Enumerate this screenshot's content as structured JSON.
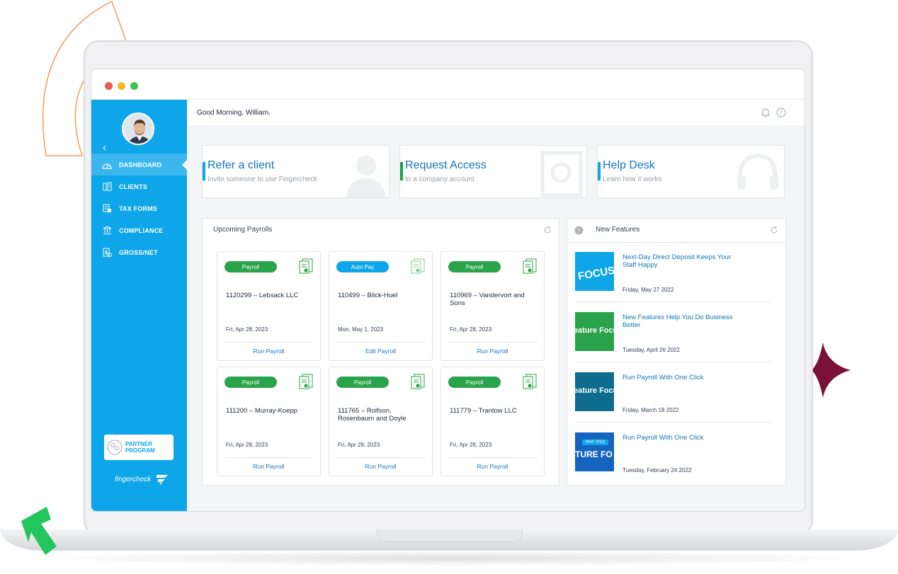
{
  "window": {
    "dot_colors": [
      "#ed5a50",
      "#f5b928",
      "#3ec44c"
    ]
  },
  "sidebar": {
    "back_icon": "chevron-left-icon",
    "items": [
      {
        "label": "DASHBOARD",
        "icon": "gauge-icon",
        "active": true
      },
      {
        "label": "CLIENTS",
        "icon": "buildings-icon",
        "active": false
      },
      {
        "label": "TAX FORMS",
        "icon": "tax-form-icon",
        "active": false
      },
      {
        "label": "COMPLIANCE",
        "icon": "bank-icon",
        "active": false
      },
      {
        "label": "GROSS/NET",
        "icon": "calculator-icon",
        "active": false
      }
    ],
    "partner": {
      "line1": "PARTNER",
      "line2": "PROGRAM"
    },
    "brand": "fingercheck"
  },
  "header": {
    "greeting": "Good Morning, William."
  },
  "quick_cards": [
    {
      "title": "Refer a client",
      "subtitle": "Invite someone to use Fingercheck",
      "accent": "#0ea5e9",
      "icon": "person-silhouette-icon"
    },
    {
      "title": "Request Access",
      "subtitle": "to a company account",
      "accent": "#16a34a",
      "icon": "vault-icon"
    },
    {
      "title": "Help Desk",
      "subtitle": "Learn how it works",
      "accent": "#0ea5e9",
      "icon": "headset-icon"
    }
  ],
  "payrolls": {
    "title": "Upcoming Payrolls",
    "cards": [
      {
        "status": "Payroll",
        "status_color": "#2aa34a",
        "name": "1120299 – Lebsack LLC",
        "date": "Fri, Apr 28, 2023",
        "action": "Run Payroll"
      },
      {
        "status": "Auto Pay",
        "status_color": "#0ea5e9",
        "name": "110499 – Blick-Huel",
        "date": "Mon, May 1, 2023",
        "action": "Edit Payroll"
      },
      {
        "status": "Payroll",
        "status_color": "#2aa34a",
        "name": "110969 – Vandervort and Sons",
        "date": "Fri, Apr 28, 2023",
        "action": "Run Payroll"
      },
      {
        "status": "Payroll",
        "status_color": "#2aa34a",
        "name": "111200 – Murray-Koepp",
        "date": "Fri, Apr 28, 2023",
        "action": "Run Payroll"
      },
      {
        "status": "Payroll",
        "status_color": "#2aa34a",
        "name": "111765 – Rolfson, Rosenbaum and Doyle",
        "date": "Fri, Apr 28, 2023",
        "action": "Run Payroll"
      },
      {
        "status": "Payroll",
        "status_color": "#2aa34a",
        "name": "111779 – Trantow LLC",
        "date": "Fri, Apr 28, 2023",
        "action": "Run Payroll"
      }
    ]
  },
  "features": {
    "title": "New Features",
    "items": [
      {
        "title": "Next-Day Direct Deposit Keeps Your Staff Happy",
        "date": "Friday, May 27 2022",
        "thumb_color": "#0ea5e9",
        "thumb_text": "FOCUS"
      },
      {
        "title": "New Features Help You Do Business Better",
        "date": "Tuesday, April 26 2022",
        "thumb_color": "#2aa34a",
        "thumb_text": "eature Focu"
      },
      {
        "title": "Run Payroll With One Click",
        "date": "Friday, March 18 2022",
        "thumb_color": "#0e6c8f",
        "thumb_text": "eature Focu"
      },
      {
        "title": "Run Payroll With One Click",
        "date": "Tuesday, February 24 2022",
        "thumb_color": "#1565c0",
        "thumb_text": "TURE FO",
        "badge": "MAY 2022"
      }
    ]
  }
}
